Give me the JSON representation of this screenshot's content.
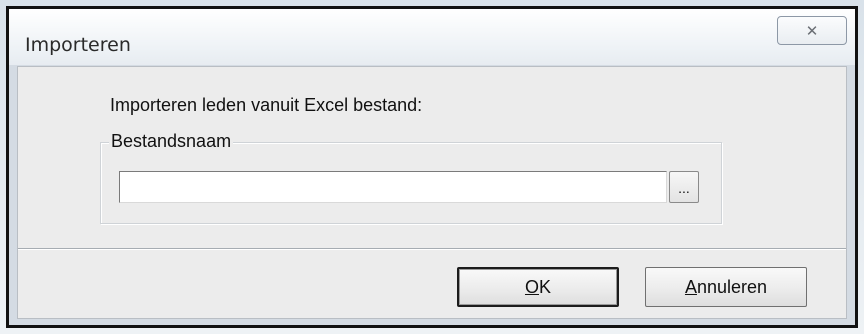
{
  "window": {
    "title": "Importeren",
    "close_glyph": "✕"
  },
  "dialog": {
    "prompt": "Importeren leden vanuit Excel bestand:",
    "group_label": "Bestandsnaam",
    "file_input": {
      "value": "",
      "placeholder": ""
    },
    "browse_label": "..."
  },
  "buttons": {
    "ok": {
      "mnemonic": "O",
      "rest": "K"
    },
    "cancel": {
      "mnemonic": "A",
      "rest": "nnuleren"
    }
  },
  "colors": {
    "titlebar": "#ffffff",
    "client": "#ececec",
    "frame": "#111111"
  }
}
